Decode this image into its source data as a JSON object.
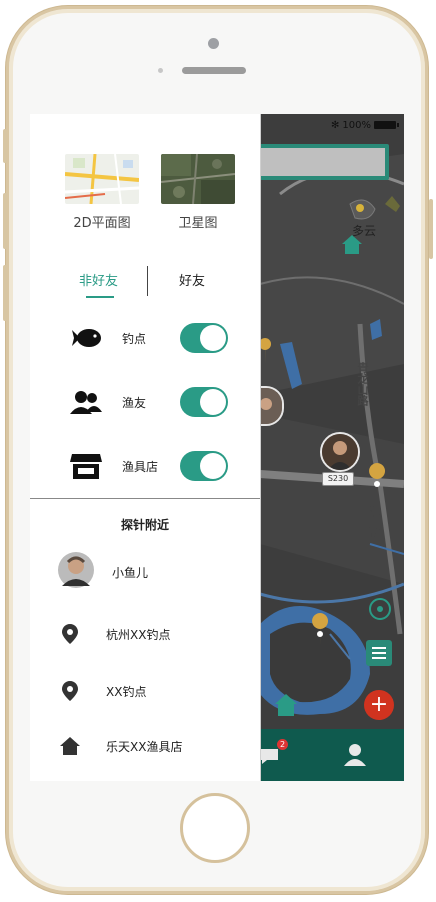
{
  "status_bar": {
    "bluetooth": "✻",
    "battery_text": "100%"
  },
  "map": {
    "weather": "多云",
    "road_label_1": "青龙山路",
    "road_label_2": "独月路",
    "road_tag": "S230",
    "message_badge": "2"
  },
  "drawer": {
    "map_types": [
      {
        "label": "2D平面图"
      },
      {
        "label": "卫星图"
      }
    ],
    "tabs": [
      {
        "label": "非好友",
        "active": true
      },
      {
        "label": "好友",
        "active": false
      }
    ],
    "layers": [
      {
        "label": "钓点",
        "icon": "fish-icon",
        "enabled": true
      },
      {
        "label": "渔友",
        "icon": "friends-icon",
        "enabled": true
      },
      {
        "label": "渔具店",
        "icon": "shop-icon",
        "enabled": true
      }
    ],
    "nearby_title": "探针附近",
    "nearby": [
      {
        "label": "小鱼儿",
        "icon": "avatar"
      },
      {
        "label": "杭州XX钓点",
        "icon": "location-pin-icon"
      },
      {
        "label": "XX钓点",
        "icon": "location-pin-icon"
      },
      {
        "label": "乐天XX渔具店",
        "icon": "home-icon"
      }
    ]
  },
  "colors": {
    "accent": "#2a9b86",
    "nav": "#0f5a4e",
    "fab": "#d1331f"
  }
}
